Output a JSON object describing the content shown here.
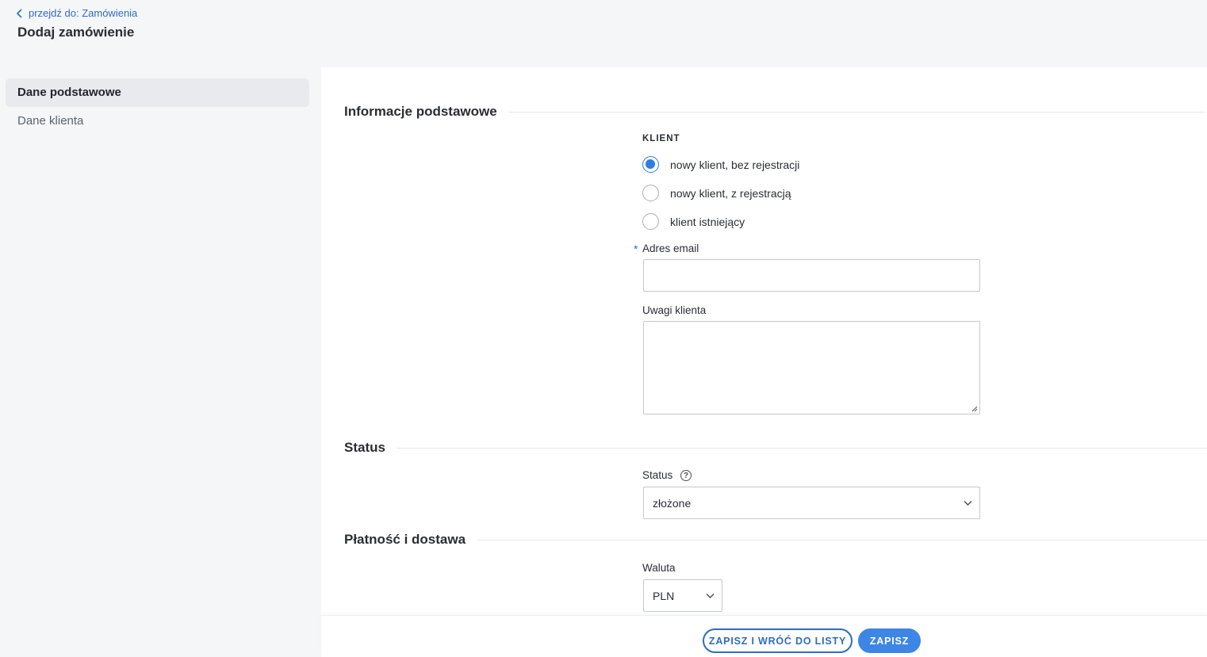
{
  "header": {
    "back_link": "przejdź do: Zamówienia",
    "page_title": "Dodaj zamówienie"
  },
  "sidebar": {
    "items": [
      {
        "label": "Dane podstawowe",
        "active": true
      },
      {
        "label": "Dane klienta",
        "active": false
      }
    ]
  },
  "sections": {
    "basic_info": {
      "title": "Informacje podstawowe"
    },
    "status": {
      "title": "Status"
    },
    "payment": {
      "title": "Płatność i dostawa"
    }
  },
  "client": {
    "label": "KLIENT",
    "options": [
      {
        "label": "nowy klient, bez rejestracji",
        "checked": true
      },
      {
        "label": "nowy klient, z rejestracją",
        "checked": false
      },
      {
        "label": "klient istniejący",
        "checked": false
      }
    ],
    "email_label": "Adres email",
    "email_required_mark": "*",
    "email_value": "",
    "notes_label": "Uwagi klienta",
    "notes_value": ""
  },
  "status_field": {
    "label": "Status",
    "help_symbol": "?",
    "value": "złożone"
  },
  "payment_field": {
    "currency_label": "Waluta",
    "currency_value": "PLN"
  },
  "footer": {
    "save_back_label": "ZAPISZ I WRÓĆ DO LISTY",
    "save_label": "ZAPISZ"
  },
  "colors": {
    "accent": "#2f6cbf",
    "primary_button": "#3d86e6",
    "radio_checked": "#2f7de1",
    "page_background": "#f5f6f8"
  },
  "icons": {
    "back": "chevron-left-icon",
    "help": "question-circle-icon",
    "dropdown": "chevron-down-icon"
  }
}
